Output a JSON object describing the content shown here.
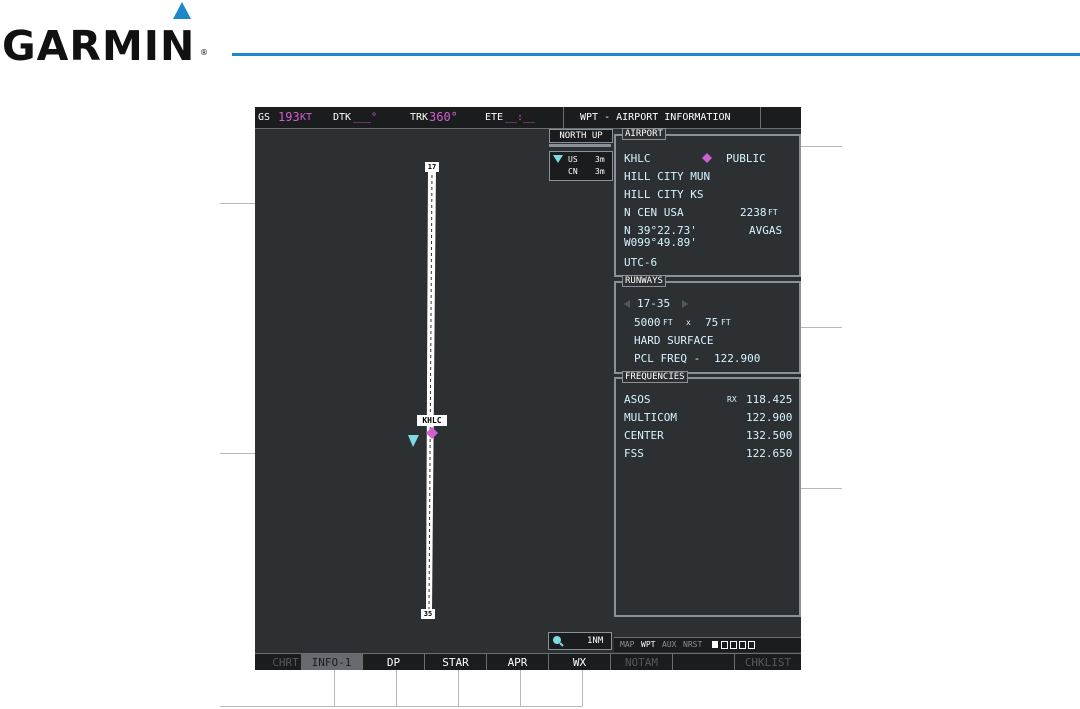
{
  "brand": {
    "name": "GARMIN",
    "reg": "®"
  },
  "topbar": {
    "gs_label": "GS",
    "gs_value": "193",
    "gs_unit": "KT",
    "dtk_label": "DTK",
    "dtk_value": "___°",
    "trk_label": "TRK",
    "trk_value": "360°",
    "ete_label": "ETE",
    "ete_value": "__:__",
    "page_title": "WPT - AIRPORT INFORMATION"
  },
  "map": {
    "orientation": "NORTH UP",
    "legend": [
      {
        "label": "US",
        "value": "3m"
      },
      {
        "label": "CN",
        "value": "3m"
      }
    ],
    "runway_end_north": "17",
    "runway_end_south": "35",
    "airport_label": "KHLC",
    "range": "1NM"
  },
  "airport": {
    "title": "AIRPORT",
    "ident": "KHLC",
    "type": "PUBLIC",
    "name": "HILL CITY MUN",
    "city": "HILL CITY KS",
    "region": "N CEN USA",
    "elevation": "2238",
    "elevation_unit": "FT",
    "lat": "N 39°22.73'",
    "lon": "W099°49.89'",
    "fuel": "AVGAS",
    "timezone": "UTC-6"
  },
  "runways": {
    "title": "RUNWAYS",
    "designation": "17-35",
    "length": "5000",
    "length_unit": "FT",
    "by": "x",
    "width": "75",
    "width_unit": "FT",
    "surface": "HARD SURFACE",
    "pcl_label": "PCL FREQ -",
    "pcl_freq": "122.900"
  },
  "frequencies": {
    "title": "FREQUENCIES",
    "items": [
      {
        "name": "ASOS",
        "prefix": "RX",
        "freq": "118.425"
      },
      {
        "name": "MULTICOM",
        "prefix": "",
        "freq": "122.900"
      },
      {
        "name": "CENTER",
        "prefix": "",
        "freq": "132.500"
      },
      {
        "name": "FSS",
        "prefix": "",
        "freq": "122.650"
      }
    ]
  },
  "page_group": {
    "labels": [
      "MAP",
      "WPT",
      "AUX",
      "NRST"
    ],
    "active": "WPT",
    "page_count": 5,
    "page_active": 1
  },
  "softkeys": [
    {
      "label": "CHRT",
      "state": "dim"
    },
    {
      "label": "INFO-1",
      "state": "selected"
    },
    {
      "label": "DP",
      "state": "normal"
    },
    {
      "label": "STAR",
      "state": "normal"
    },
    {
      "label": "APR",
      "state": "normal"
    },
    {
      "label": "WX",
      "state": "normal"
    },
    {
      "label": "NOTAM",
      "state": "dim"
    },
    {
      "label": "",
      "state": "normal"
    },
    {
      "label": "CHKLIST",
      "state": "dim"
    }
  ],
  "colors": {
    "accent_blue": "#1c88c9",
    "magenta": "#d060d0",
    "cyan": "#d6f4ff",
    "screen_bg": "#2d3033"
  }
}
